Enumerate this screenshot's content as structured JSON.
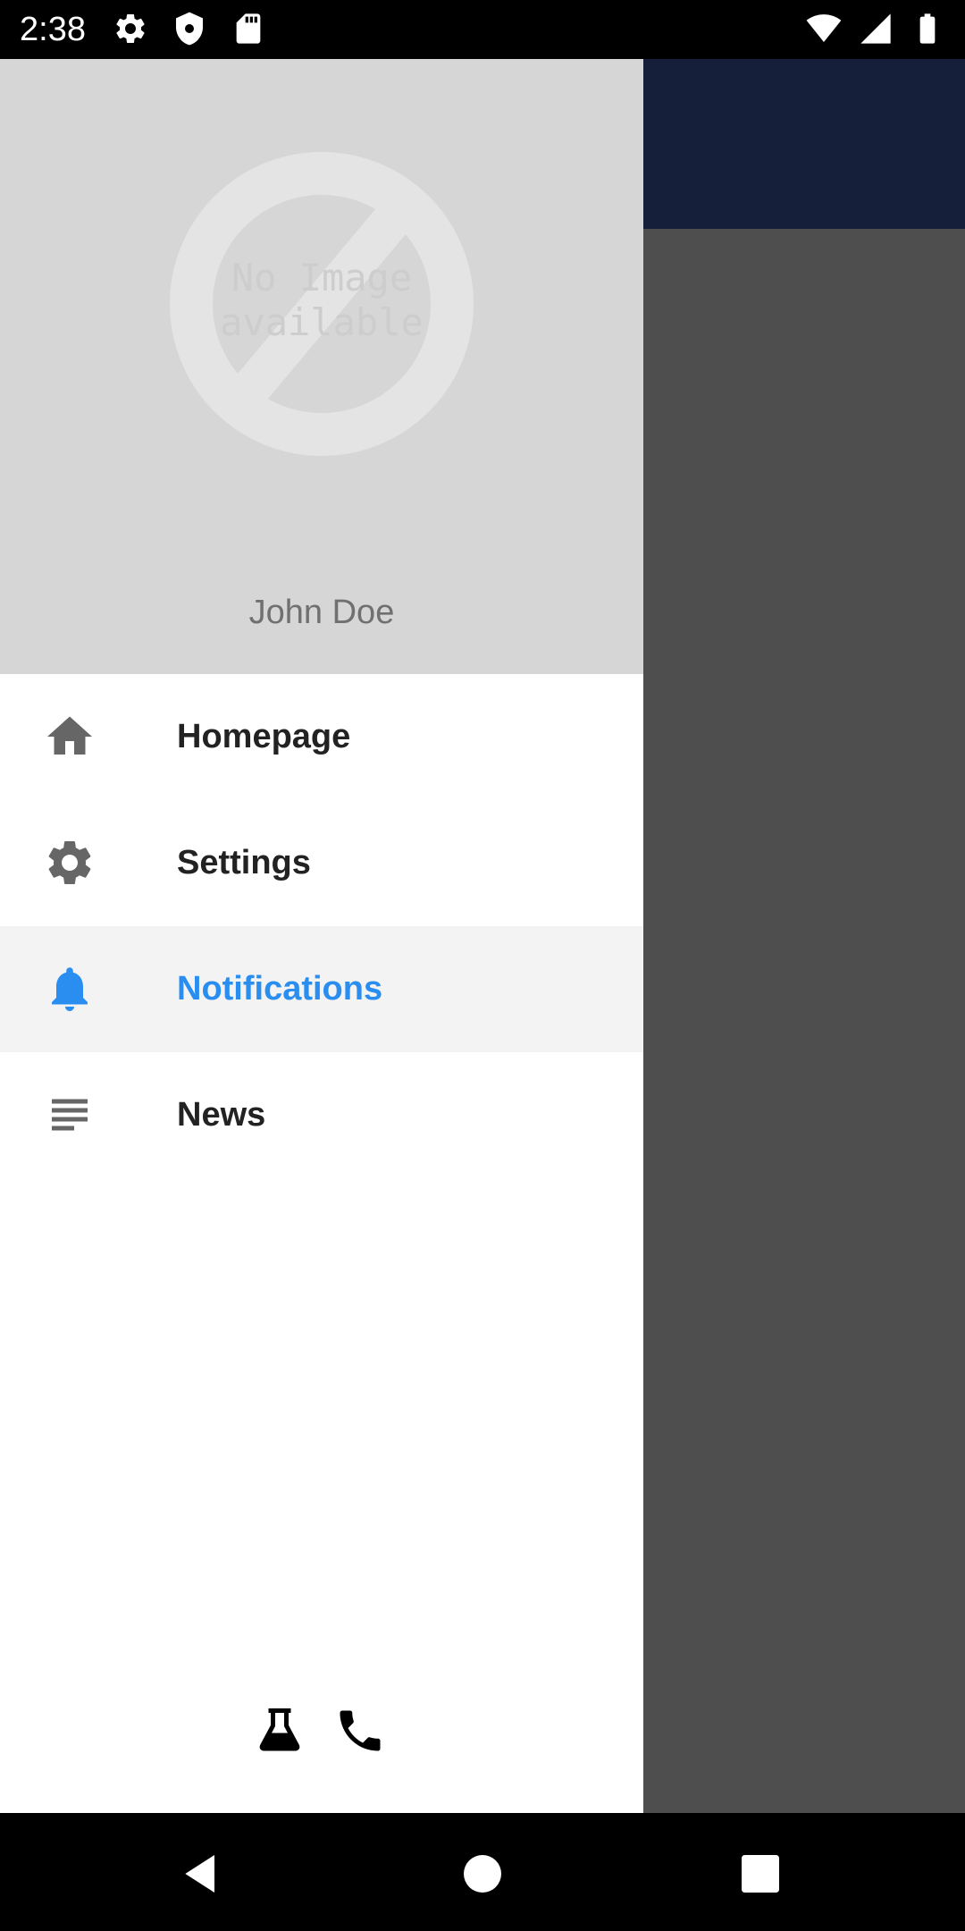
{
  "status_bar": {
    "time": "2:38",
    "left_icons": [
      "gear-icon",
      "shield-icon",
      "sd-card-icon"
    ],
    "right_icons": [
      "wifi-icon",
      "cell-signal-icon",
      "battery-icon"
    ]
  },
  "drawer": {
    "header": {
      "avatar_placeholder_text": "No Image\navailable",
      "user_name": "John Doe"
    },
    "menu": [
      {
        "label": "Homepage",
        "icon": "home-icon",
        "active": false
      },
      {
        "label": "Settings",
        "icon": "gear-icon",
        "active": false
      },
      {
        "label": "Notifications",
        "icon": "bell-icon",
        "active": true
      },
      {
        "label": "News",
        "icon": "news-icon",
        "active": false
      }
    ],
    "footer_icons": [
      "flask-icon",
      "phone-icon"
    ]
  },
  "colors": {
    "status_bar": "#000000",
    "header_bg": "#d6d6d6",
    "active_item_bg": "#f3f3f3",
    "accent": "#2a8df0",
    "menu_text": "#222222",
    "menu_icon": "#666666",
    "backdrop": "#4e4e4e",
    "toolbar_behind": "#151f3a"
  },
  "nav_bar": {
    "buttons": [
      "back-icon",
      "home-circle-icon",
      "recents-icon"
    ]
  }
}
